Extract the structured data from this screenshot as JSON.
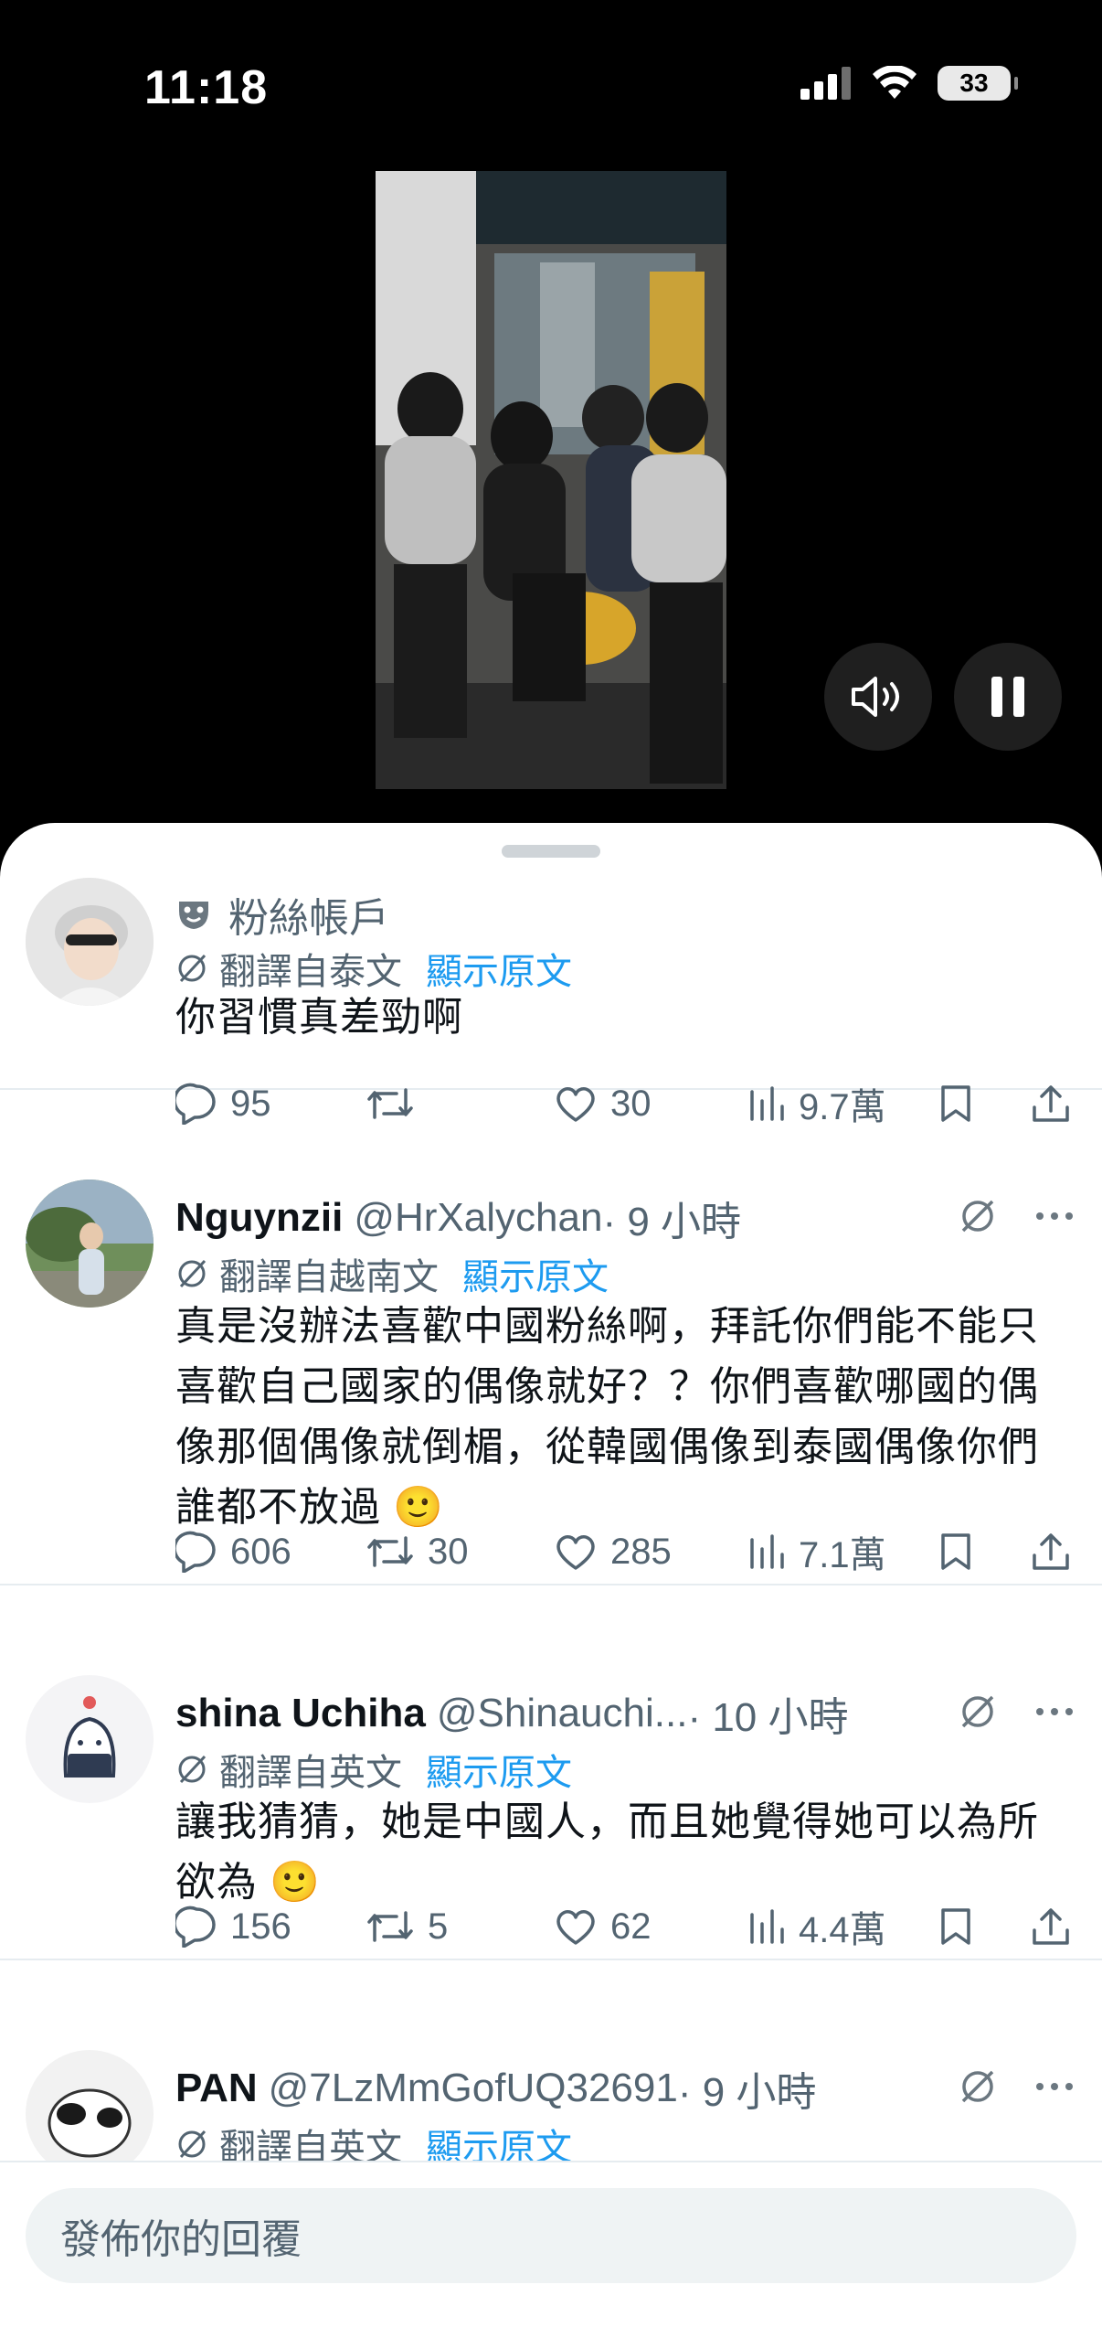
{
  "status_bar": {
    "time": "11:18",
    "battery": "33"
  },
  "tweets": [
    {
      "account_label": "粉絲帳戶",
      "translated_from": "翻譯自泰文",
      "show_original": "顯示原文",
      "text": "你習慣真差勁啊",
      "stats": {
        "replies": "95",
        "reposts": "",
        "likes": "30",
        "views": "9.7萬"
      }
    },
    {
      "name": "Nguynzii",
      "handle": "@HrXalychan",
      "time": "· 9 小時",
      "translated_from": "翻譯自越南文",
      "show_original": "顯示原文",
      "text": "真是沒辦法喜歡中國粉絲啊，拜託你們能不能只喜歡自己國家的偶像就好？？你們喜歡哪國的偶像那個偶像就倒楣，從韓國偶像到泰國偶像你們誰都不放過 🙂",
      "stats": {
        "replies": "606",
        "reposts": "30",
        "likes": "285",
        "views": "7.1萬"
      }
    },
    {
      "name": "shina Uchiha",
      "handle": "@Shinauchi...",
      "time": "· 10 小時",
      "translated_from": "翻譯自英文",
      "show_original": "顯示原文",
      "text": "讓我猜猜，她是中國人，而且她覺得她可以為所欲為 🙂",
      "stats": {
        "replies": "156",
        "reposts": "5",
        "likes": "62",
        "views": "4.4萬"
      }
    },
    {
      "name": "PAN",
      "handle": "@7LzMmGofUQ32691",
      "time": "· 9 小時",
      "translated_from": "翻譯自英文",
      "show_original": "顯示原文"
    }
  ],
  "reply_bar": {
    "placeholder": "發佈你的回覆"
  },
  "colors": {
    "link": "#1d9bf0",
    "secondary": "#536471",
    "text": "#0f1419"
  },
  "icons": [
    "mute-icon",
    "pause-icon",
    "reply-icon",
    "repost-icon",
    "like-icon",
    "views-icon",
    "bookmark-icon",
    "share-icon",
    "translate-icon",
    "more-icon",
    "grok-icon"
  ]
}
